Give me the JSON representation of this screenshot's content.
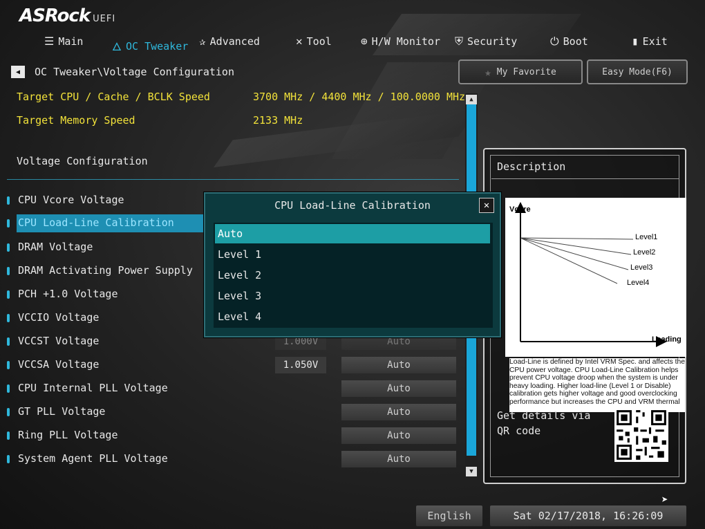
{
  "brand": {
    "name": "ASRock",
    "suffix": "UEFI"
  },
  "nav": [
    {
      "label": "Main",
      "icon": "list-icon",
      "glyph": "☰"
    },
    {
      "label": "OC Tweaker",
      "icon": "flame-icon",
      "glyph": "🜂",
      "active": true
    },
    {
      "label": "Advanced",
      "icon": "star-icon",
      "glyph": "✰"
    },
    {
      "label": "Tool",
      "icon": "tools-icon",
      "glyph": "✕"
    },
    {
      "label": "H/W Monitor",
      "icon": "monitor-icon",
      "glyph": "⊕"
    },
    {
      "label": "Security",
      "icon": "shield-icon",
      "glyph": "⛨"
    },
    {
      "label": "Boot",
      "icon": "power-icon",
      "glyph": "⏻"
    },
    {
      "label": "Exit",
      "icon": "exit-icon",
      "glyph": "▮"
    }
  ],
  "breadcrumb": "OC Tweaker\\Voltage Configuration",
  "favorite_label": "My Favorite",
  "easy_mode_label": "Easy Mode(F6)",
  "targets": [
    {
      "label": "Target CPU / Cache / BCLK Speed",
      "value": "3700 MHz / 4400 MHz / 100.0000 MHz"
    },
    {
      "label": "Target Memory Speed",
      "value": "2133 MHz"
    }
  ],
  "section_title": "Voltage Configuration",
  "settings": [
    {
      "label": "CPU Vcore Voltage",
      "value": "",
      "option": ""
    },
    {
      "label": "CPU Load-Line Calibration",
      "value": "",
      "option": "",
      "selected": true
    },
    {
      "label": "DRAM Voltage",
      "value": "",
      "option": ""
    },
    {
      "label": "DRAM Activating Power Supply",
      "value": "",
      "option": ""
    },
    {
      "label": "PCH +1.0 Voltage",
      "value": "",
      "option": ""
    },
    {
      "label": "VCCIO Voltage",
      "value": "",
      "option": ""
    },
    {
      "label": "VCCST Voltage",
      "value": "1.000V",
      "option": "Auto"
    },
    {
      "label": "VCCSA Voltage",
      "value": "1.050V",
      "option": "Auto"
    },
    {
      "label": "CPU Internal PLL Voltage",
      "value": "",
      "option": "Auto"
    },
    {
      "label": "GT PLL Voltage",
      "value": "",
      "option": "Auto"
    },
    {
      "label": "Ring PLL Voltage",
      "value": "",
      "option": "Auto"
    },
    {
      "label": "System Agent PLL Voltage",
      "value": "",
      "option": "Auto"
    }
  ],
  "description": {
    "title": "Description",
    "graph_y_label": "Vcore",
    "graph_x_label": "Loading",
    "graph_levels": [
      "Level1",
      "Level2",
      "Level3",
      "Level4"
    ],
    "text": "Load-Line is defined by Intel VRM Spec. and affects the CPU power voltage. CPU Load-Line Calibration helps prevent CPU voltage droop when the system is under heavy loading. Higher load-line (Level 1 or Disable) calibration gets higher voltage and good overclocking performance but increases the CPU and VRM thermal",
    "qr_text": "Get details via QR code"
  },
  "language": "English",
  "datetime": "Sat 02/17/2018, 16:26:09",
  "dialog": {
    "title": "CPU Load-Line Calibration",
    "options": [
      "Auto",
      "Level 1",
      "Level 2",
      "Level 3",
      "Level 4"
    ],
    "selected_index": 0
  }
}
